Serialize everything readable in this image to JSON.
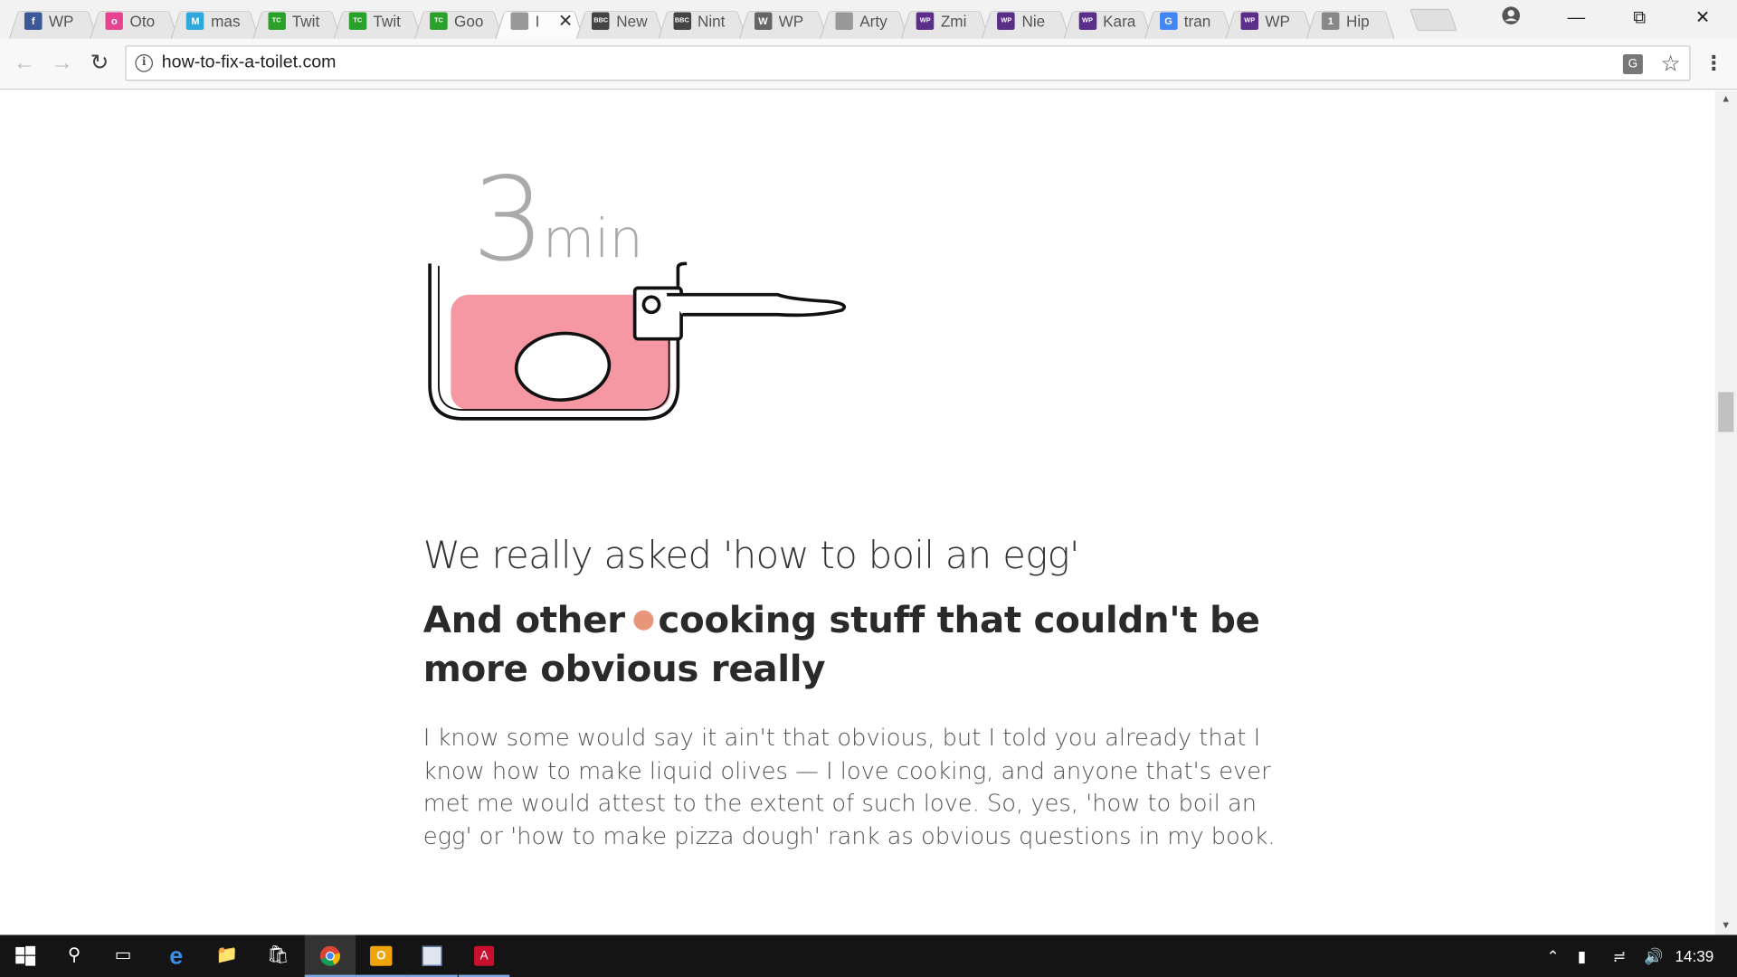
{
  "browser": {
    "tabs": [
      {
        "title": "WP",
        "favicon": "facebook-icon",
        "color": "#3b5998",
        "glyph": "f"
      },
      {
        "title": "Oto",
        "favicon": "otomoto-icon",
        "color": "#e84393",
        "glyph": "o"
      },
      {
        "title": "mas",
        "favicon": "mastodon-icon",
        "color": "#2fa8e0",
        "glyph": "M"
      },
      {
        "title": "Twit",
        "favicon": "techcrunch-icon",
        "color": "#2aa12a",
        "glyph": "TC"
      },
      {
        "title": "Twit",
        "favicon": "techcrunch-icon",
        "color": "#2aa12a",
        "glyph": "TC"
      },
      {
        "title": "Goo",
        "favicon": "techcrunch-icon",
        "color": "#2aa12a",
        "glyph": "TC"
      },
      {
        "title": "I",
        "favicon": "page-icon",
        "color": "#999999",
        "glyph": "",
        "active": true
      },
      {
        "title": "New",
        "favicon": "bbc-icon",
        "color": "#444444",
        "glyph": "BBC"
      },
      {
        "title": "Nint",
        "favicon": "bbc-icon",
        "color": "#444444",
        "glyph": "BBC"
      },
      {
        "title": "WP",
        "favicon": "wp-icon",
        "color": "#666666",
        "glyph": "W"
      },
      {
        "title": "Arty",
        "favicon": "page-icon",
        "color": "#999999",
        "glyph": ""
      },
      {
        "title": "Zmi",
        "favicon": "wp-icon",
        "color": "#5b2e8a",
        "glyph": "WP"
      },
      {
        "title": "Nie",
        "favicon": "wp-icon",
        "color": "#5b2e8a",
        "glyph": "WP"
      },
      {
        "title": "Kara",
        "favicon": "wp-icon",
        "color": "#5b2e8a",
        "glyph": "WP"
      },
      {
        "title": "tran",
        "favicon": "google-icon",
        "color": "#4285f4",
        "glyph": "G"
      },
      {
        "title": "WP",
        "favicon": "wp-icon",
        "color": "#5b2e8a",
        "glyph": "WP"
      },
      {
        "title": "Hip",
        "favicon": "counter-icon",
        "color": "#888888",
        "glyph": "1"
      }
    ],
    "url": "how-to-fix-a-toilet.com"
  },
  "illustration": {
    "timer_number": "3",
    "timer_unit": "min",
    "water_color": "#f598a3"
  },
  "article": {
    "subheading": "We really asked 'how to boil an egg'",
    "heading_part1": "And other",
    "heading_part2": "cooking stuff that couldn't be more obvious really",
    "dot_color": "#e8957a",
    "body": "I know some would say it ain't that obvious, but I told you already that I know how to make liquid olives — I love cooking, and anyone that's ever met me would attest to the extent of such love. So, yes, 'how to boil an egg' or 'how to make pizza dough' rank as obvious questions in my book."
  },
  "taskbar": {
    "clock": "14:39"
  }
}
